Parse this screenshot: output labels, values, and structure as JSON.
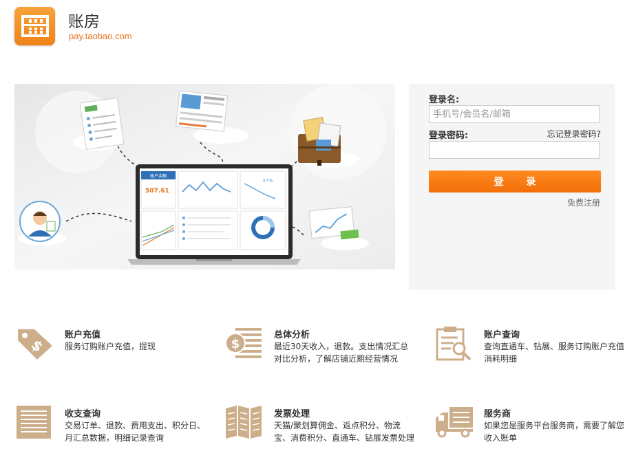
{
  "header": {
    "logo_icon": "abacus-icon",
    "brand_name": "账房",
    "brand_url": "pay.taobao.com"
  },
  "banner": {
    "card_title": "账户余额",
    "balance": "507.61",
    "percent": "37%"
  },
  "login": {
    "username_label": "登录名:",
    "username_placeholder": "手机号/会员名/邮箱",
    "username_value": "",
    "password_label": "登录密码:",
    "forgot_link": "忘记登录密码?",
    "password_value": "",
    "submit_label": "登 录",
    "register_link": "免费注册",
    "accent_color": "#f57a12"
  },
  "features": [
    {
      "title": "账户充值",
      "desc": "服务订购账户充值，提现",
      "icon": "price-tag-dollar-icon"
    },
    {
      "title": "总体分析",
      "desc": "最近30天收入，退款。支出情况汇总对比分析，了解店铺近期经营情况",
      "icon": "coin-report-icon"
    },
    {
      "title": "账户查询",
      "desc": "查询直通车、钻展、服务订购账户充值消耗明细",
      "icon": "clipboard-search-icon"
    },
    {
      "title": "收支查询",
      "desc": "交易订单、退款、费用支出、积分日、月汇总数据，明细记录查询",
      "icon": "ledger-icon"
    },
    {
      "title": "发票处理",
      "desc": "天猫/聚划算佣金、返点积分、物流宝、消费积分、直通车、钻展发票处理",
      "icon": "invoice-folder-icon"
    },
    {
      "title": "服务商",
      "desc": "如果您是服务平台服务商，需要了解您收入账单",
      "icon": "delivery-truck-icon"
    }
  ]
}
